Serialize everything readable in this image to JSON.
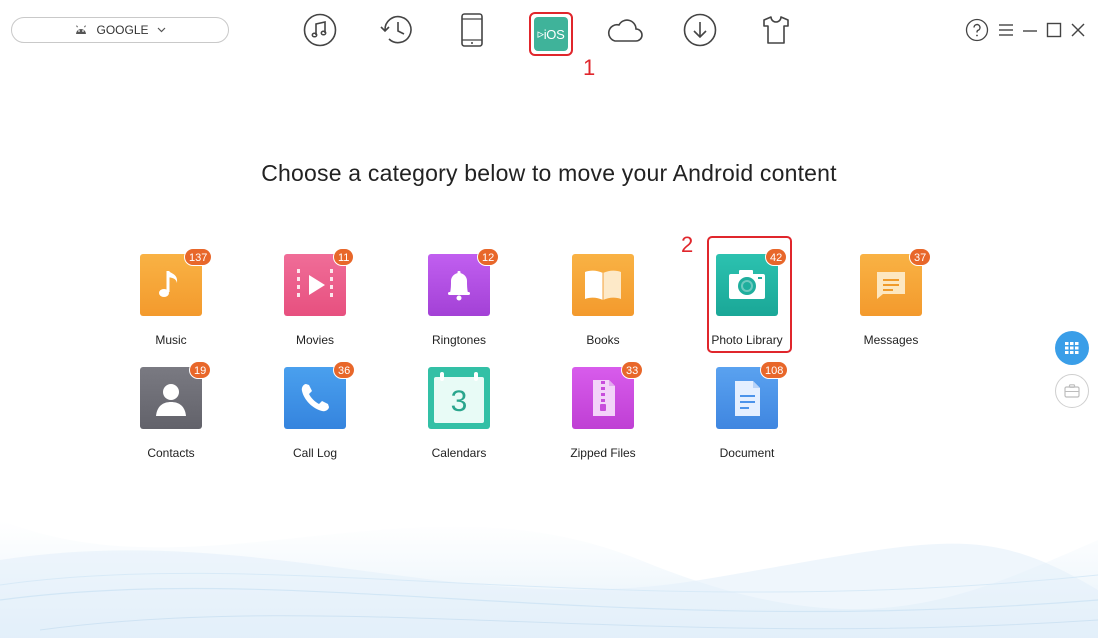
{
  "device": {
    "name": "GOOGLE"
  },
  "toolbar": {
    "ios_label": "iOS",
    "items": [
      "music-icon",
      "history-icon",
      "phone-icon",
      "to-ios-icon",
      "cloud-icon",
      "download-icon",
      "shirt-icon"
    ]
  },
  "annotations": {
    "step1": "1",
    "step2": "2"
  },
  "headline": "Choose a category below to move your Android content",
  "categories": [
    {
      "label": "Music",
      "count": "137",
      "color": "#f7a43a"
    },
    {
      "label": "Movies",
      "count": "11",
      "color": "#ec5f8e"
    },
    {
      "label": "Ringtones",
      "count": "12",
      "color": "#b14fe0"
    },
    {
      "label": "Books",
      "count": "",
      "color": "#f7a43a"
    },
    {
      "label": "Photo Library",
      "count": "42",
      "color": "#22b5a4"
    },
    {
      "label": "Messages",
      "count": "37",
      "color": "#f7a43a"
    },
    {
      "label": "Contacts",
      "count": "19",
      "color": "#6f6f78"
    },
    {
      "label": "Call Log",
      "count": "36",
      "color": "#3f8fe6"
    },
    {
      "label": "Calendars",
      "count": "",
      "calendar_day": "3",
      "color": "#33c0a6"
    },
    {
      "label": "Zipped Files",
      "count": "33",
      "color": "#cf4de0"
    },
    {
      "label": "Document",
      "count": "108",
      "color": "#4b93ea"
    }
  ],
  "colors": {
    "accent_red": "#e0262c",
    "badge": "#e8672a",
    "side_active": "#3a9ee8"
  }
}
